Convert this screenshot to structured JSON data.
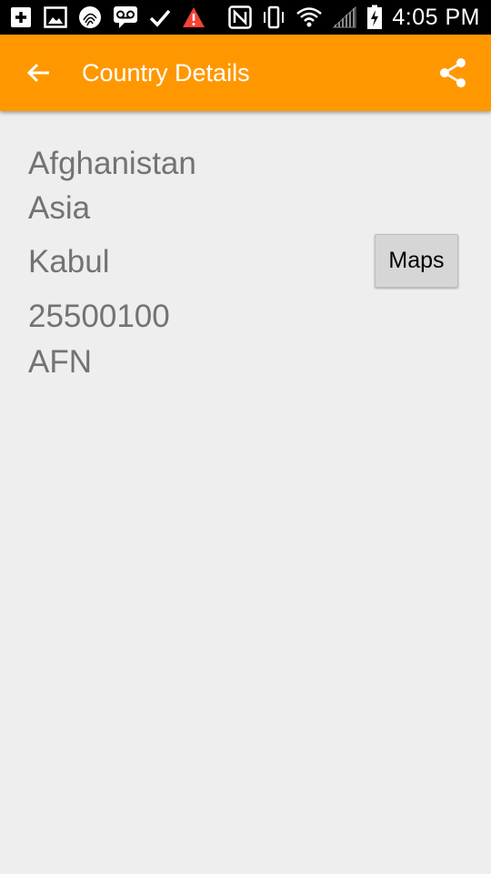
{
  "status_bar": {
    "time": "4:05 PM",
    "left_icons": [
      "add-box-icon",
      "image-icon",
      "fingerprint-icon",
      "voicemail-icon",
      "check-icon",
      "warning-icon"
    ],
    "right_icons": [
      "nfc-icon",
      "vibrate-icon",
      "wifi-icon",
      "signal-icon",
      "battery-charging-icon"
    ],
    "warning_color": "#f44336"
  },
  "app_bar": {
    "title": "Country Details",
    "color": "#ff9800"
  },
  "country": {
    "name": "Afghanistan",
    "region": "Asia",
    "capital": "Kabul",
    "population": "25500100",
    "currency": "AFN"
  },
  "buttons": {
    "maps_label": "Maps"
  }
}
